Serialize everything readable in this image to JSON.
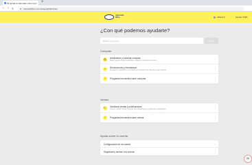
{
  "browser": {
    "tab_title": "Mi ayuda en Mercado Libre Arg",
    "tab_close": "×",
    "new_tab": "+",
    "back": "‹",
    "forward": "›",
    "reload": "↻",
    "url": "mercadolibre.com.ar/ayuda/tabs/view"
  },
  "header": {
    "logo_line1": "mercado",
    "logo_line2": "libre",
    "user": "Aldana ▾",
    "help": "Ayuda / PQR"
  },
  "main": {
    "title": "¿Con qué podemos ayudarte?",
    "search_placeholder": "Buscar en Ayuda",
    "search_button": "Buscar"
  },
  "sections": {
    "compras": {
      "title": "Compras",
      "items": [
        {
          "label": "Administrar y cancelar compras",
          "sub": "Pagar, seguir envíos, modificar, reclamar o cancelar compras.",
          "icon": "🛍"
        },
        {
          "label": "Devoluciones y reembolsos",
          "sub": "Devolver un producto o consultar por reintegros de dinero de una compra.",
          "icon": "↩"
        },
        {
          "label": "Preguntas frecuentes sobre compras",
          "sub": "",
          "icon": "?"
        }
      ]
    },
    "ventas": {
      "title": "Ventas",
      "items": [
        {
          "label": "Gestionar ventas y publicaciones",
          "sub": "Vender, cobrar, enviar, mejorar las publicaciones y gestionar la reputación.",
          "icon": "🏷"
        },
        {
          "label": "Preguntas frecuentes sobre ventas",
          "sub": "",
          "icon": "?"
        }
      ]
    },
    "cuenta": {
      "title": "Ayuda sobre tu cuenta",
      "items": [
        {
          "label": "Configuración de mi cuenta"
        },
        {
          "label": "Seguridad y acceso a la cuenta"
        }
      ]
    },
    "chevron": "›"
  },
  "fab": {
    "icon": "chat-icon",
    "glyph": "✉"
  }
}
